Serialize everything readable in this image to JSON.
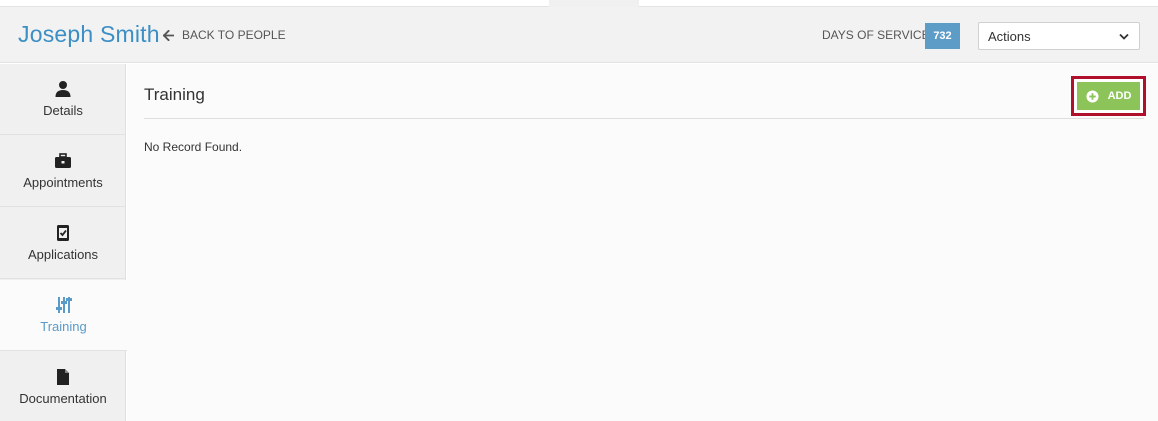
{
  "header": {
    "person_name": "Joseph Smith",
    "back_label": "BACK TO PEOPLE",
    "days_of_service_label": "DAYS OF SERVICE",
    "days_of_service_value": "732",
    "actions_selected": "Actions"
  },
  "sidebar": {
    "items": [
      {
        "label": "Details",
        "icon": "user-icon"
      },
      {
        "label": "Appointments",
        "icon": "briefcase-icon"
      },
      {
        "label": "Applications",
        "icon": "checked-document-icon"
      },
      {
        "label": "Training",
        "icon": "sliders-icon",
        "active": true
      },
      {
        "label": "Documentation",
        "icon": "file-icon"
      }
    ]
  },
  "main": {
    "section_title": "Training",
    "add_label": "ADD",
    "empty_message": "No Record Found."
  },
  "colors": {
    "name_blue": "#3b8fc4",
    "badge_blue": "#5e9cc8",
    "add_green": "#8dc45a",
    "highlight_red": "#b0102b",
    "active_blue": "#5a9ac8"
  }
}
